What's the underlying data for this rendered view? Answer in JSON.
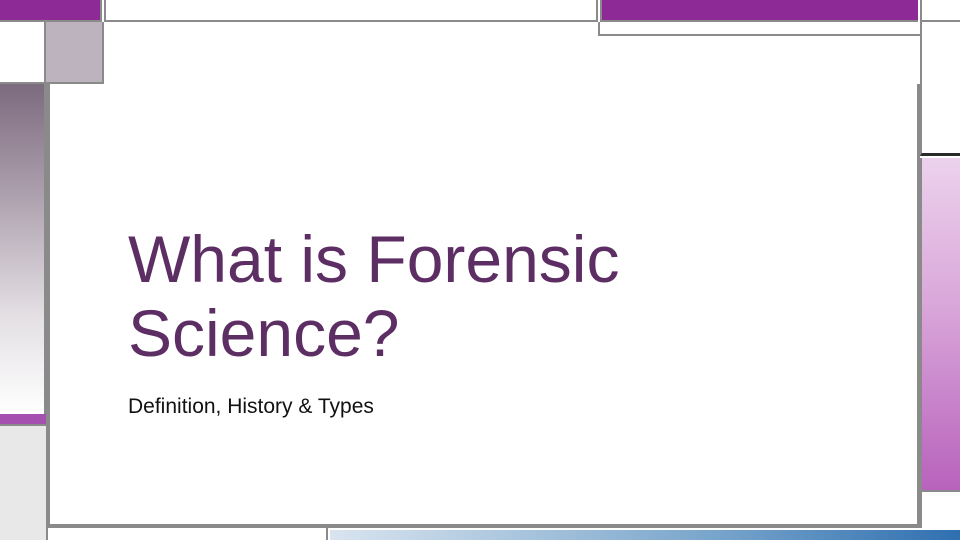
{
  "slide": {
    "title": "What is Forensic Science?",
    "subtitle": "Definition, History & Types"
  },
  "colors": {
    "accent_purple": "#8e2a96",
    "title_color": "#5d2e63",
    "frame_gray": "#8a8a8a",
    "bottom_blue": "#2f6fb0"
  }
}
